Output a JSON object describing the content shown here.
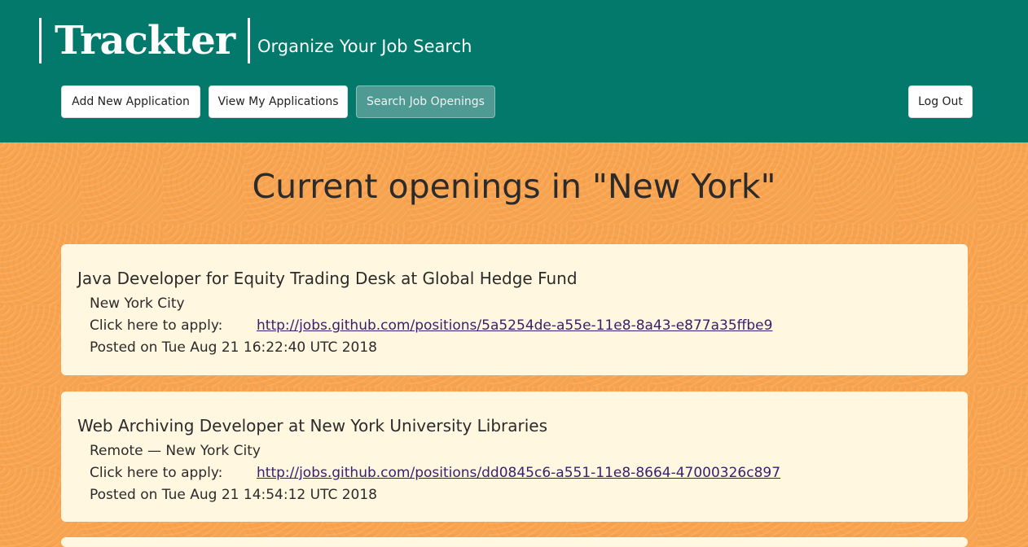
{
  "app": {
    "name": "Trackter",
    "tagline": "Organize Your Job Search"
  },
  "nav": {
    "add_new": "Add New Application",
    "view_mine": "View My Applications",
    "search": "Search Job Openings",
    "logout": "Log Out"
  },
  "main": {
    "title": "Current openings in \"New York\""
  },
  "jobs": [
    {
      "title": "Java Developer for Equity Trading Desk at Global Hedge Fund",
      "location": "New York City",
      "apply_label": "Click here to apply:",
      "apply_url": "http://jobs.github.com/positions/5a5254de-a55e-11e8-8a43-e877a35ffbe9",
      "posted": "Posted on Tue Aug 21 16:22:40 UTC 2018"
    },
    {
      "title": "Web Archiving Developer at New York University Libraries",
      "location": "Remote — New York City",
      "apply_label": "Click here to apply:",
      "apply_url": "http://jobs.github.com/positions/dd0845c6-a551-11e8-8664-47000326c897",
      "posted": "Posted on Tue Aug 21 14:54:12 UTC 2018"
    }
  ],
  "colors": {
    "header": "#02796b",
    "background": "#f7a451",
    "card": "#fff7e0",
    "link": "#3b1d6e"
  }
}
